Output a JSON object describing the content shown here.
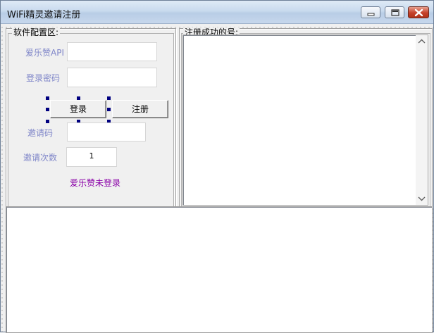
{
  "window": {
    "title": "WiFi精灵邀请注册",
    "controls": {
      "minimize": "minimize-icon",
      "maximize": "maximize-icon",
      "close": "close-icon"
    }
  },
  "config_group": {
    "legend": "软件配置区:",
    "api_label": "爱乐赞API",
    "api_value": "",
    "password_label": "登录密码",
    "password_value": "",
    "login_button": "登录",
    "register_button": "注册",
    "invite_code_label": "邀请码",
    "invite_code_value": "",
    "invite_count_label": "邀请次数",
    "invite_count_value": "1",
    "status": "爱乐赞未登录"
  },
  "results_group": {
    "legend": "注册成功的号:",
    "items": []
  },
  "log_area": {
    "text": ""
  },
  "colors": {
    "label": "#7f86c9",
    "status": "#8a00a8",
    "selection_handle": "#000080",
    "title_bar": "#c9daee"
  }
}
